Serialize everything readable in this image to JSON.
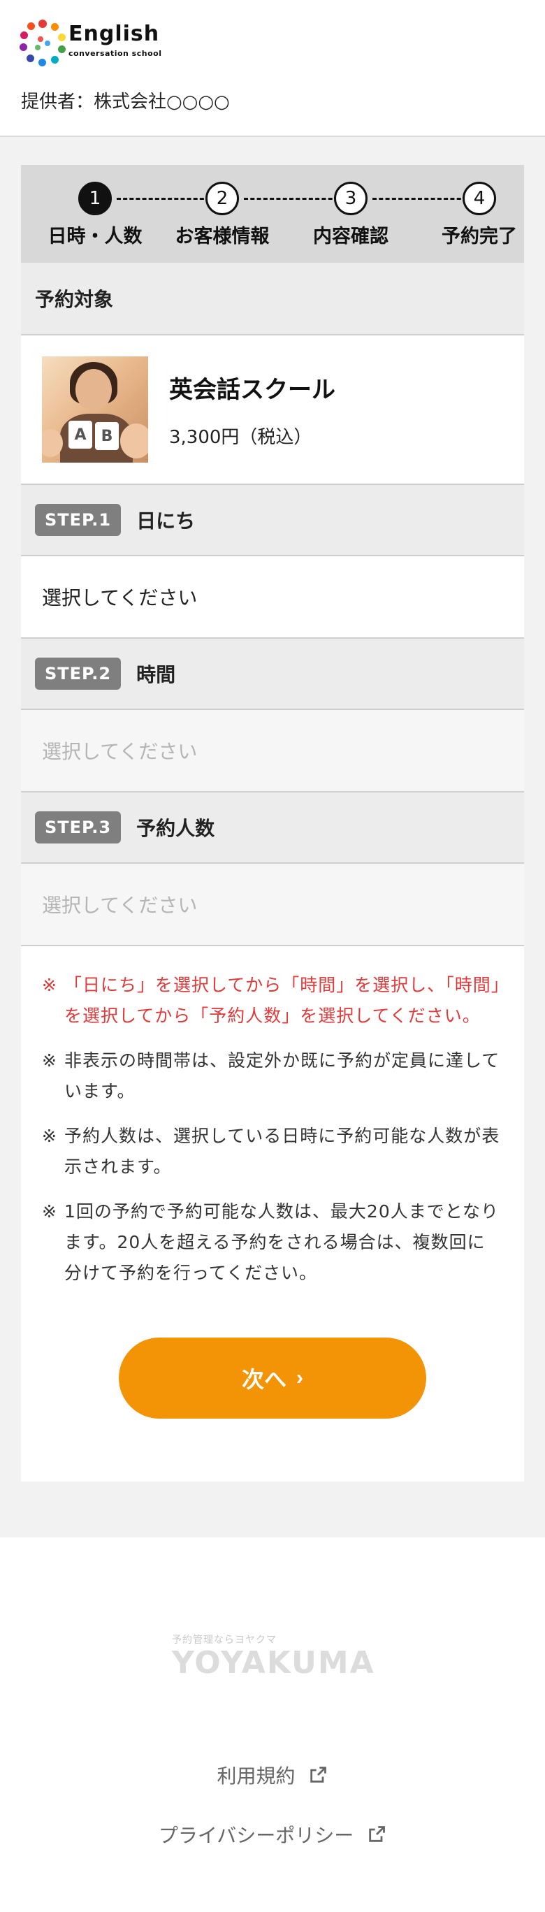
{
  "header": {
    "logo_title": "English",
    "logo_subtitle": "conversation school",
    "provider": "提供者：株式会社○○○○"
  },
  "progress": {
    "steps": [
      {
        "num": "1",
        "label": "日時・人数",
        "active": true
      },
      {
        "num": "2",
        "label": "お客様情報",
        "active": false
      },
      {
        "num": "3",
        "label": "内容確認",
        "active": false
      },
      {
        "num": "4",
        "label": "予約完了",
        "active": false
      }
    ]
  },
  "target": {
    "heading": "予約対象",
    "name": "英会話スクール",
    "price": "3,300円（税込）"
  },
  "steps": [
    {
      "badge": "STEP.1",
      "title": "日にち",
      "placeholder": "選択してください",
      "enabled": true
    },
    {
      "badge": "STEP.2",
      "title": "時間",
      "placeholder": "選択してください",
      "enabled": false
    },
    {
      "badge": "STEP.3",
      "title": "予約人数",
      "placeholder": "選択してください",
      "enabled": false
    }
  ],
  "notes": {
    "mark": "※",
    "items": [
      "「日にち」を選択してから「時間」を選択し、「時間」を選択してから「予約人数」を選択してください。",
      "非表示の時間帯は、設定外か既に予約が定員に達しています。",
      "予約人数は、選択している日時に予約可能な人数が表示されます。",
      "1回の予約で予約可能な人数は、最大20人までとなります。20人を超える予約をされる場合は、複数回に分けて予約を行ってください。"
    ]
  },
  "next_button": {
    "label": "次へ",
    "chevron": "›"
  },
  "footer": {
    "brand_small": "予約管理ならヨヤクマ",
    "brand": "YOYAKUMA",
    "terms": "利用規約",
    "privacy": "プライバシーポリシー"
  },
  "colors": {
    "accent": "#f29406",
    "note_red": "#e03a3a",
    "badge": "#7f7f7f"
  }
}
